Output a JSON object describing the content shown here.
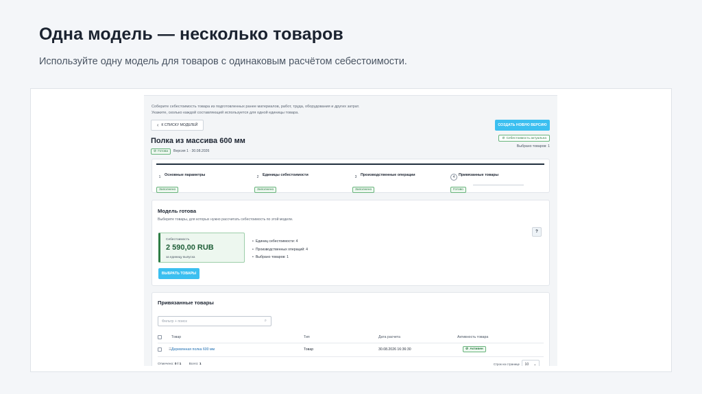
{
  "slide": {
    "title": "Одна модель — несколько товаров",
    "subtitle": "Используйте одну модель для товаров с одинаковым расчётом себестоимости."
  },
  "app": {
    "intro_line1": "Соберите себестоимость товара из подготовленных ранее материалов, работ, труда, оборудования и других затрат.",
    "intro_line2": "Укажите, сколько каждой составляющей используется для одной единицы товара.",
    "back_label": "К списку моделей",
    "create_version_label": "Создать новую версию",
    "model_title": "Полка из массива 600 мм",
    "status_badge": "Готова",
    "version": "Версия 1 · 30.08.2026",
    "cost_actual_label": "Себестоимость актуальна",
    "selected_products": "Выбрано товаров: 1"
  },
  "steps": [
    {
      "num": "1",
      "label": "Основные параметры",
      "badge": "Заполнено"
    },
    {
      "num": "2",
      "label": "Единицы себестоимости",
      "badge": "Заполнено"
    },
    {
      "num": "3",
      "label": "Производственные операции",
      "badge": "Заполнено"
    },
    {
      "num": "4",
      "label": "Привязанные товары",
      "badge": "Готово"
    }
  ],
  "ready": {
    "title": "Модель готова",
    "description": "Выберите товары, для которых нужно рассчитать себестоимость по этой модели.",
    "help": "?",
    "cost_label": "Себестоимость",
    "cost_value": "2 590,00 RUB",
    "cost_per": "за единицу выпуска",
    "stats": [
      "Единиц себестоимости: 4",
      "Производственных операций: 4",
      "Выбрано товаров: 1"
    ],
    "select_button": "Выбрать товары"
  },
  "linked": {
    "title": "Привязанные товары",
    "filter_placeholder": "Фильтр + поиск",
    "columns": [
      "Товар",
      "Тип",
      "Дата расчета",
      "Активность товара"
    ],
    "rows": [
      {
        "product": "Деревянная полка 600 мм",
        "type": "Товар",
        "date": "30.08.2026 16:36:30",
        "status": "Активен"
      }
    ],
    "marked_label": "Отмечено:",
    "marked_value": "0 / 1",
    "total_label": "Всего:",
    "total_value": "1",
    "rows_per_page_label": "Строк на странице",
    "rows_per_page_value": "10"
  },
  "colors": {
    "accent": "#3bbff0",
    "success": "#2e7d45",
    "stepper_line": "#1f2d3d"
  },
  "icons": {
    "back": "chevron-left-icon",
    "check": "check-circle-icon",
    "search": "search-icon",
    "drag": "drag-handle-icon",
    "dropdown": "chevron-down-icon"
  }
}
